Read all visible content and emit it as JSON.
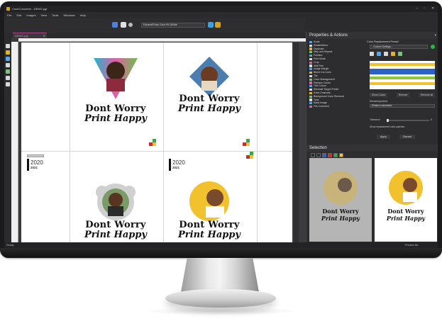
{
  "window": {
    "title": "ColorConverter - DEMO.pgt",
    "controls": [
      "–",
      "▫",
      "✕"
    ]
  },
  "menu": [
    "File",
    "Edit",
    "Images",
    "View",
    "Tools",
    "Windows",
    "Help"
  ],
  "toolbar": {
    "output_select": "Expand/Ruby Color Kit (White",
    "icons": [
      "flip-icon",
      "print-icon",
      "settings-icon",
      "refresh-icon",
      "color-icon"
    ]
  },
  "document_tab": {
    "label": "DEMO.pgt",
    "close": "✕"
  },
  "designs": [
    {
      "line1": "Dont Worry",
      "line2": "Print Happy",
      "shape": "triangle"
    },
    {
      "line1": "Dont Worry",
      "line2": "Print Happy",
      "shape": "diamond"
    },
    {
      "line1": "Dont Worry",
      "line2": "Print Happy",
      "shape": "scalloped"
    },
    {
      "line1": "Dont Worry",
      "line2": "Print Happy",
      "shape": "circle"
    }
  ],
  "calendar_labels": [
    {
      "year": "2020",
      "sub": "2021"
    },
    {
      "year": "2020",
      "sub": "2021"
    }
  ],
  "properties_panel": {
    "title": "Properties & Actions",
    "actions": [
      "Scale",
      "Rotate/Mirror",
      "Duplicate",
      "Step and Repeat",
      "Position",
      "Print Mode",
      "Crop",
      "Add/Trim",
      "Image Margin",
      "Bleed Cut Lines",
      "Tile",
      "Color Management",
      "Replace Colors",
      "Trim Colors",
      "Simulate Target Printer",
      "Extra Channels",
      "Background Color Removal",
      "Tone",
      "Mask Image",
      "File Comment"
    ],
    "color_replace": {
      "heading": "Color Replacement Preset",
      "preset": "- Custom Settings -",
      "buttons": [
        "Show Colors",
        "Remove",
        "Remove all"
      ],
      "rendering_intent_label": "Rendering intent",
      "rendering_intent_value": "Relative colorimetric",
      "tolerance_label": "Tolerance",
      "tolerance_value": "0",
      "checkbox_label": "Show replacement color patches",
      "apply": "Apply",
      "discard": "Discard"
    }
  },
  "selection_panel": {
    "title": "Selection",
    "thumb_line1": "Dont Worry",
    "thumb_line2": "Print Happy"
  },
  "status": {
    "left": "Ready",
    "right": "Preview list"
  },
  "colors": {
    "accent_magenta": "#b8408a",
    "panel_bg": "#2d2d2f",
    "yellow": "#f2c12e",
    "swatch_red": "#d62828",
    "swatch_green": "#3aa84a",
    "swatch_yellow": "#f2c12e",
    "swatch_blue": "#2a62c9"
  }
}
